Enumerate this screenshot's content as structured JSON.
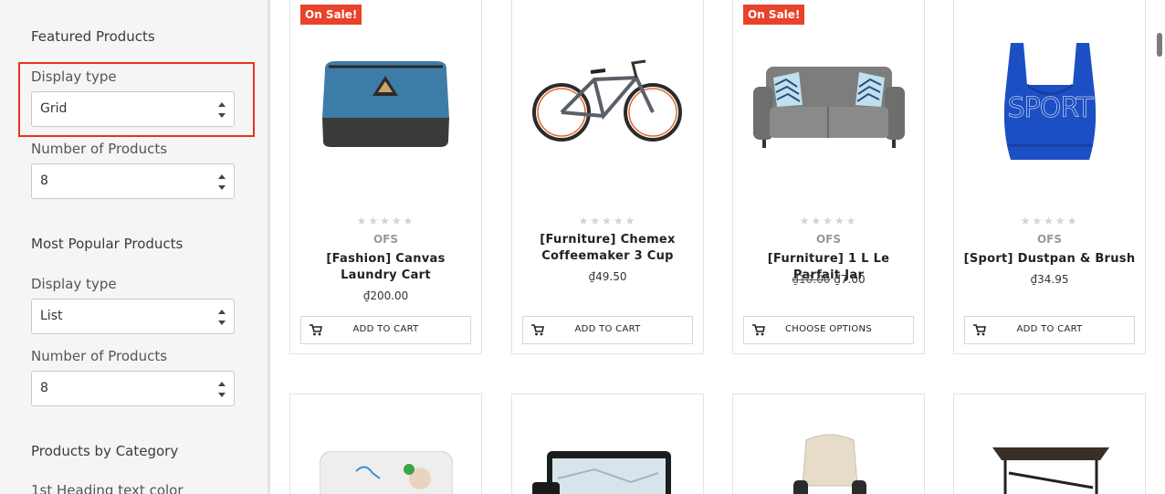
{
  "sidebar": {
    "featured": {
      "title": "Featured Products",
      "display_type_label": "Display type",
      "display_type_value": "Grid",
      "num_label": "Number of Products",
      "num_value": "8"
    },
    "popular": {
      "title": "Most Popular Products",
      "display_type_label": "Display type",
      "display_type_value": "List",
      "num_label": "Number of Products",
      "num_value": "8"
    },
    "category": {
      "title": "Products by Category",
      "heading_color_label": "1st Heading text color"
    }
  },
  "products": [
    {
      "sale_badge": "On Sale!",
      "rating_stars": "★★★★★",
      "brand": "OFS",
      "name": "[Fashion] Canvas Laundry Cart",
      "price": "₫200.00",
      "button": "ADD TO CART",
      "icon": "cart-icon"
    },
    {
      "rating_stars": "★★★★★",
      "name": "[Furniture] Chemex Coffeemaker 3 Cup",
      "price": "₫49.50",
      "button": "ADD TO CART",
      "icon": "cart-icon"
    },
    {
      "sale_badge": "On Sale!",
      "rating_stars": "★★★★★",
      "brand": "OFS",
      "name": "[Furniture] 1 L Le Parfait Jar",
      "old_price": "₫10.00",
      "price": "₫7.00",
      "button": "CHOOSE OPTIONS",
      "icon": "cart-icon"
    },
    {
      "rating_stars": "★★★★★",
      "brand": "OFS",
      "name": "[Sport] Dustpan & Brush",
      "price": "₫34.95",
      "button": "ADD TO CART",
      "icon": "cart-icon"
    }
  ],
  "colors": {
    "sale_badge": "#e8422b",
    "highlight": "#e8321f",
    "sidebar_bg": "#f5f5f5"
  }
}
